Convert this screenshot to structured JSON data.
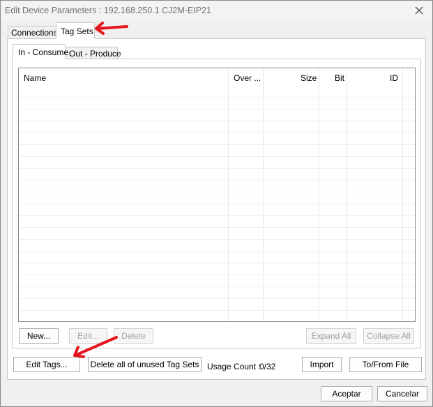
{
  "window": {
    "title": "Edit Device Parameters : 192.168.250.1 CJ2M-EIP21"
  },
  "outer_tabs": [
    {
      "label": "Connections"
    },
    {
      "label": "Tag Sets"
    }
  ],
  "inner_tabs": [
    {
      "label": "In - Consume"
    },
    {
      "label": "Out - Produce"
    }
  ],
  "grid": {
    "columns": [
      {
        "label": "Name"
      },
      {
        "label": "Over ..."
      },
      {
        "label": "Size"
      },
      {
        "label": "Bit"
      },
      {
        "label": "ID"
      }
    ],
    "rows": []
  },
  "inner_buttons": {
    "new": "New...",
    "edit": "Edit...",
    "delete": "Delete",
    "expand_all": "Expand All",
    "collapse_all": "Collapse All"
  },
  "outer_buttons": {
    "edit_tags": "Edit Tags...",
    "delete_unused": "Delete all of unused Tag Sets",
    "usage_count_label": "Usage Count :",
    "usage_count_value": "0/32",
    "import": "Import",
    "to_from_file": "To/From File"
  },
  "dialog_buttons": {
    "accept": "Aceptar",
    "cancel": "Cancelar"
  },
  "annotation_color": "#e3161b"
}
